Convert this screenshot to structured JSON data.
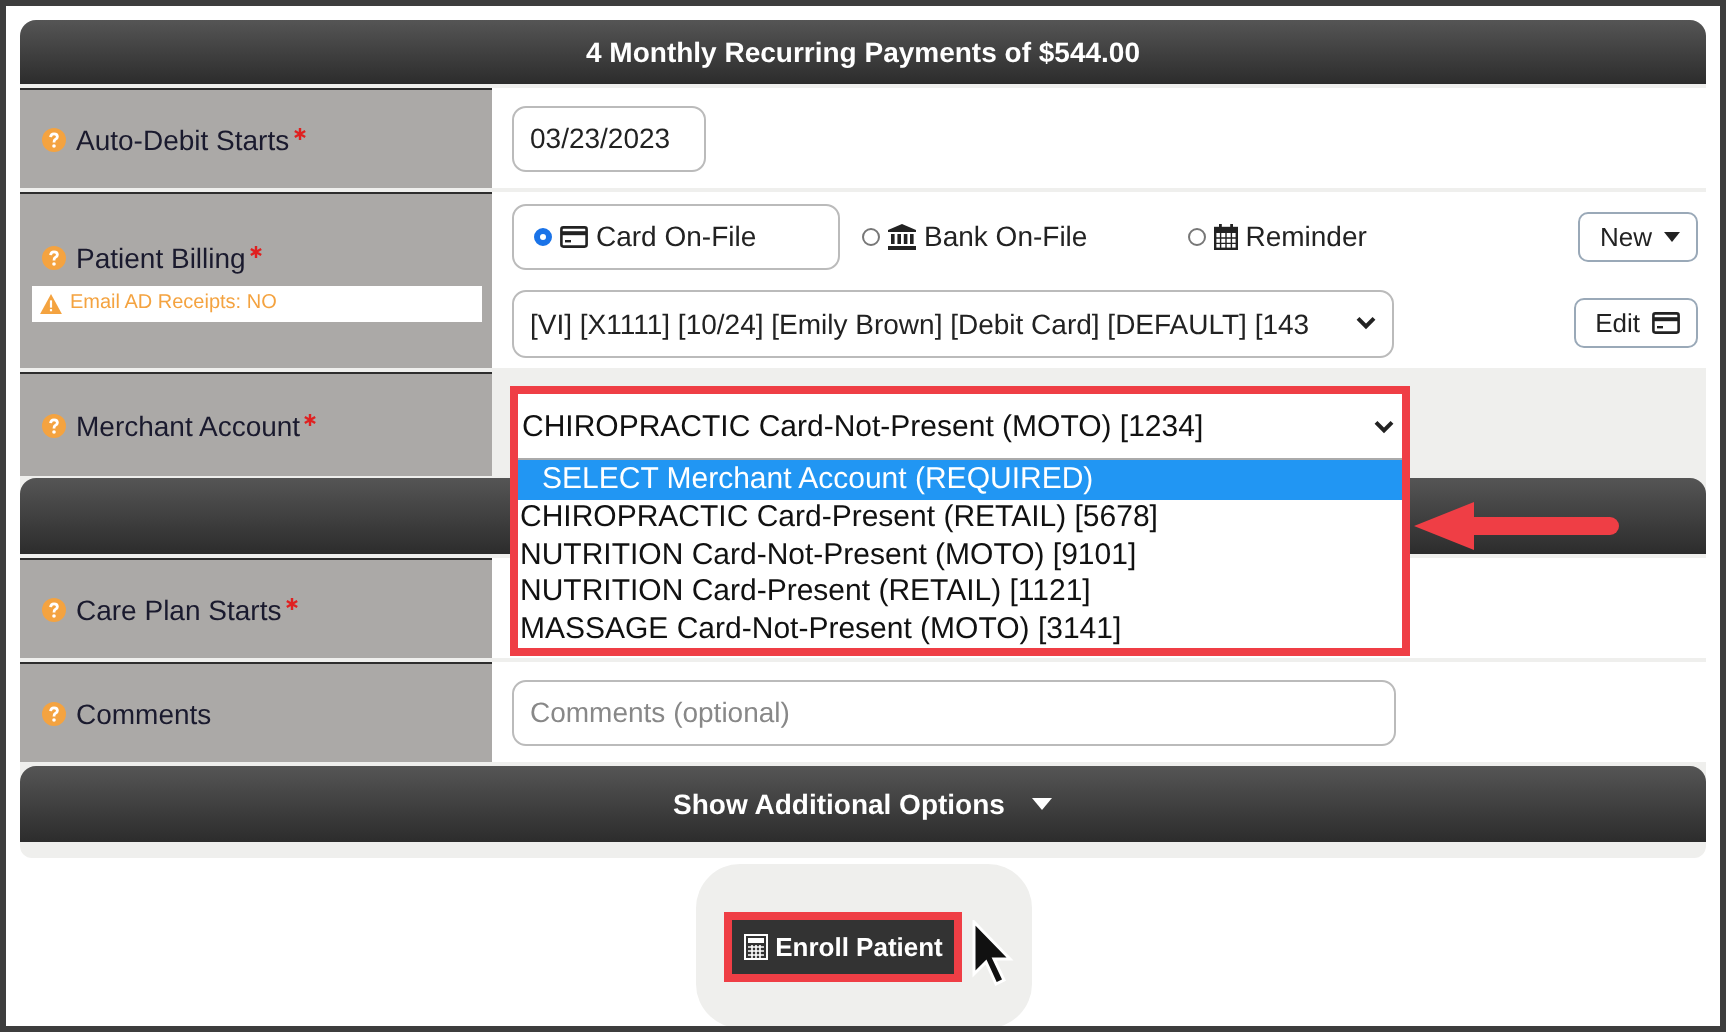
{
  "header": {
    "title": "4 Monthly Recurring Payments of $544.00"
  },
  "auto_debit": {
    "label": "Auto-Debit Starts",
    "required": true,
    "value": "03/23/2023"
  },
  "patient_billing": {
    "label": "Patient Billing",
    "required": true,
    "notice": "Email AD Receipts: NO",
    "methods": [
      {
        "label": "Card On-File",
        "kind": "card",
        "selected": true
      },
      {
        "label": "Bank On-File",
        "kind": "bank",
        "selected": false
      },
      {
        "label": "Reminder",
        "kind": "calendar",
        "selected": false
      }
    ],
    "card_select": "[VI] [X1111] [10/24] [Emily Brown] [Debit Card] [DEFAULT] [143",
    "new_button": "New",
    "edit_button": "Edit"
  },
  "merchant_account": {
    "label": "Merchant Account",
    "required": true,
    "value": "CHIROPRACTIC Card-Not-Present (MOTO) [1234]",
    "expanded": true,
    "options": [
      {
        "label": "SELECT Merchant Account (REQUIRED)",
        "selected": true
      },
      {
        "label": "CHIROPRACTIC Card-Present (RETAIL) [5678]",
        "selected": false
      },
      {
        "label": "NUTRITION Card-Not-Present (MOTO) [9101]",
        "selected": false
      },
      {
        "label": "NUTRITION Card-Present (RETAIL) [1121]",
        "selected": false
      },
      {
        "label": "MASSAGE Card-Not-Present (MOTO) [3141]",
        "selected": false
      }
    ]
  },
  "care_plan": {
    "label": "Care Plan Starts",
    "required": true
  },
  "comments": {
    "label": "Comments",
    "required": false,
    "placeholder": "Comments (optional)"
  },
  "additional_options": {
    "label": "Show Additional Options",
    "expanded": false
  },
  "enroll_button": {
    "label": "Enroll Patient"
  }
}
